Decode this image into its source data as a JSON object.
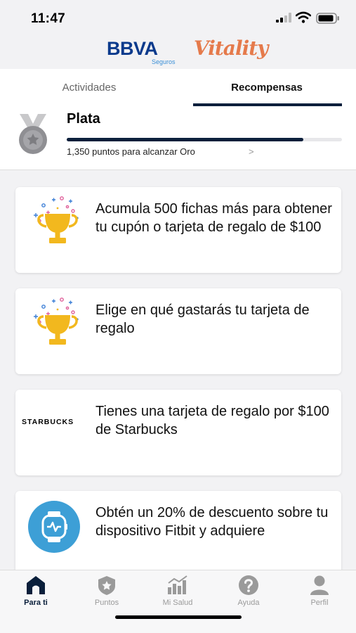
{
  "status": {
    "time": "11:47"
  },
  "brand": {
    "bbva": "BBVA",
    "seguros": "Seguros",
    "vitality": "Vitality"
  },
  "tabs": [
    {
      "label": "Actividades",
      "active": false
    },
    {
      "label": "Recompensas",
      "active": true
    }
  ],
  "level": {
    "name": "Plata",
    "progress_fraction": 0.86,
    "subtitle": "1,350 puntos para alcanzar Oro",
    "chevron": ">"
  },
  "cards": [
    {
      "icon": "trophy-icon",
      "text": "Acumula 500 fichas más para obtener tu cupón o tarjeta de regalo de $100"
    },
    {
      "icon": "trophy-icon",
      "text": "Elige en qué gastarás tu tarjeta de regalo"
    },
    {
      "icon": "starbucks-logo",
      "logo_text": "STARBUCKS",
      "text": "Tienes una tarjeta de regalo por $100 de Starbucks"
    },
    {
      "icon": "fitbit-watch-icon",
      "text": "Obtén un 20% de descuento sobre tu dispositivo Fitbit y adquiere"
    }
  ],
  "nav": [
    {
      "label": "Para ti",
      "icon": "home-icon",
      "active": true
    },
    {
      "label": "Puntos",
      "icon": "star-badge-icon",
      "active": false
    },
    {
      "label": "Mi Salud",
      "icon": "bar-chart-icon",
      "active": false
    },
    {
      "label": "Ayuda",
      "icon": "help-icon",
      "active": false
    },
    {
      "label": "Perfil",
      "icon": "profile-icon",
      "active": false
    }
  ],
  "colors": {
    "primary": "#0a1f3b",
    "bbva_blue": "#0b3a8c",
    "vitality_orange": "#e57a4b",
    "trophy_gold": "#f2b81e",
    "fitbit_blue": "#3d9fd6"
  }
}
